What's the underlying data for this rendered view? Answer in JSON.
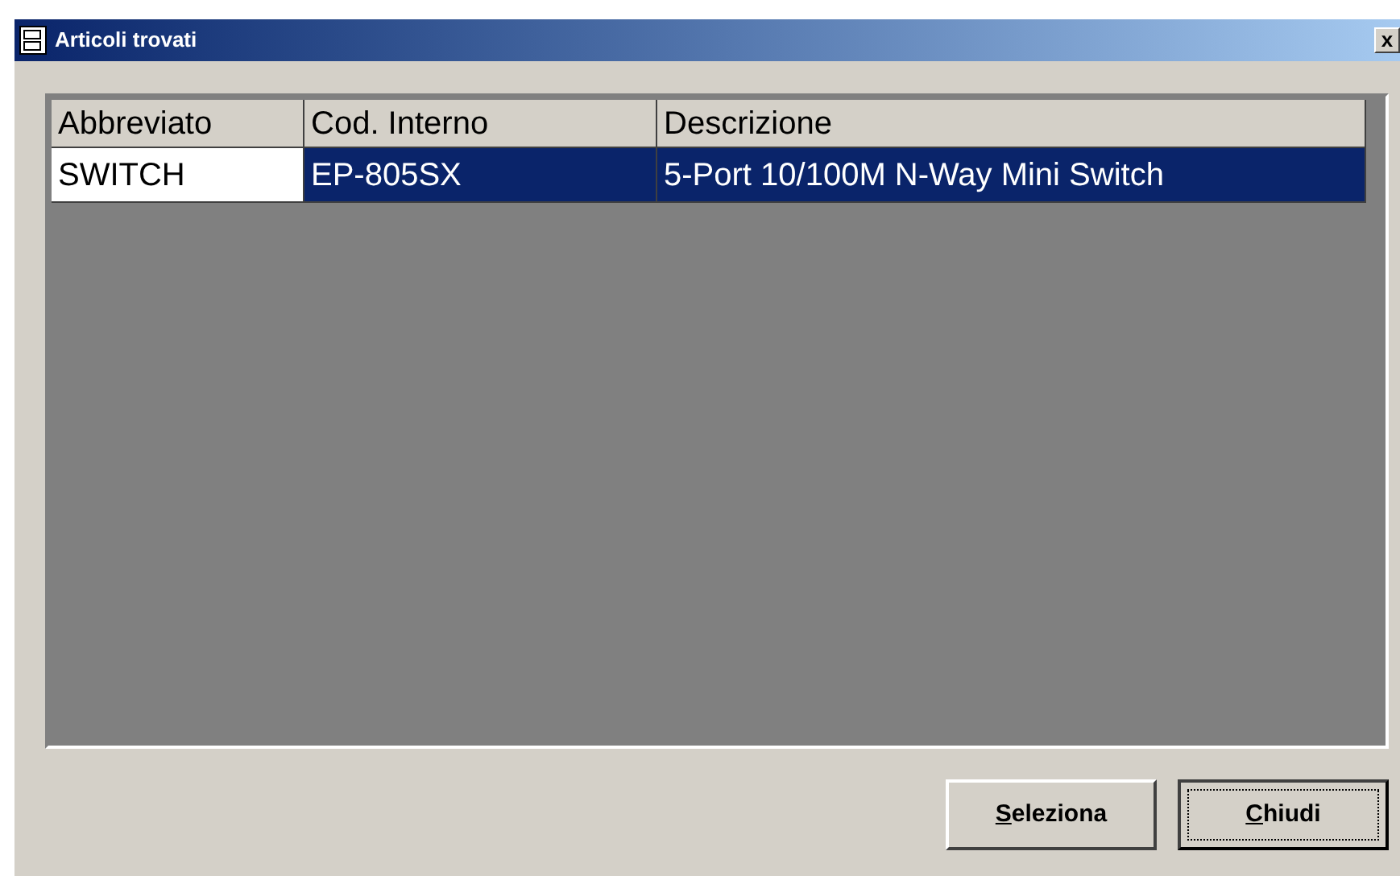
{
  "window": {
    "title": "Articoli trovati",
    "close": "x"
  },
  "table": {
    "columns": [
      "Abbreviato",
      "Cod. Interno",
      "Descrizione"
    ],
    "rows": [
      {
        "selected": true,
        "cells": [
          {
            "text": "SWITCH",
            "focused": true
          },
          {
            "text": "EP-805SX",
            "focused": false
          },
          {
            "text": "5-Port 10/100M N-Way Mini Switch",
            "focused": false
          }
        ]
      }
    ]
  },
  "buttons": [
    {
      "label": "Seleziona",
      "default": false
    },
    {
      "label": "Chiudi",
      "default": true
    }
  ]
}
